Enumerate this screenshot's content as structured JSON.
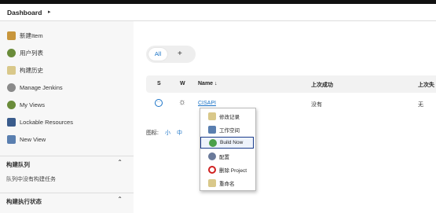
{
  "breadcrumb": {
    "label": "Dashboard",
    "chevron": "▸"
  },
  "sidebar": {
    "items": [
      {
        "label": "新建Item",
        "icon": "new-item-icon"
      },
      {
        "label": "用户列表",
        "icon": "users-icon"
      },
      {
        "label": "构建历史",
        "icon": "history-icon"
      },
      {
        "label": "Manage Jenkins",
        "icon": "gear-icon"
      },
      {
        "label": "My Views",
        "icon": "user-views-icon"
      },
      {
        "label": "Lockable Resources",
        "icon": "lock-resources-icon"
      },
      {
        "label": "New View",
        "icon": "folder-icon"
      }
    ],
    "build_queue": {
      "title": "构建队列",
      "body": "队列中没有构建任务",
      "chevron": "⌃"
    },
    "executor_status": {
      "title": "构建执行状态",
      "chevron": "⌃"
    }
  },
  "tabs": {
    "all": "All",
    "add": "+"
  },
  "table": {
    "headers": {
      "s": "S",
      "w": "W",
      "name": "Name ↓",
      "last_success": "上次成功",
      "last_failure": "上次失"
    },
    "row": {
      "status": "···",
      "weather": "☼",
      "name": "CISAPI",
      "last_success": "没有",
      "last_failure": "无"
    }
  },
  "legend": {
    "label": "图标:",
    "small": "小",
    "medium": "中"
  },
  "context_menu": {
    "items": [
      {
        "label": "修改记录",
        "icon": "changes-icon"
      },
      {
        "label": "工作空间",
        "icon": "workspace-folder-icon"
      },
      {
        "label": "Build Now",
        "icon": "build-now-icon"
      },
      {
        "label": "配置",
        "icon": "configure-gear-icon"
      },
      {
        "label": "删除 Project",
        "icon": "delete-icon"
      },
      {
        "label": "重命名",
        "icon": "rename-icon"
      }
    ]
  },
  "colors": {
    "accent": "#1a73c7",
    "topbar": "#111111"
  }
}
